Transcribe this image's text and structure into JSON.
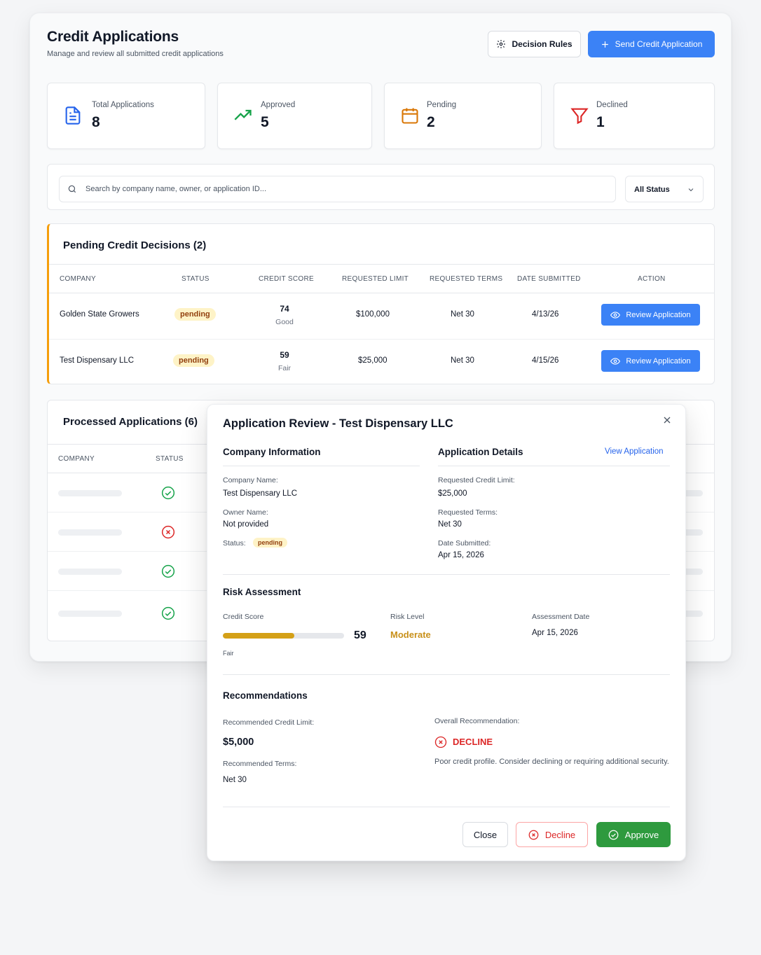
{
  "header": {
    "title": "Credit Applications",
    "subtitle": "Manage and review all submitted credit applications",
    "decision_rules_label": "Decision Rules",
    "send_label": "Send Credit Application"
  },
  "stats": [
    {
      "label": "Total Applications",
      "value": "8"
    },
    {
      "label": "Approved",
      "value": "5"
    },
    {
      "label": "Pending",
      "value": "2"
    },
    {
      "label": "Declined",
      "value": "1"
    }
  ],
  "search": {
    "placeholder": "Search by company name, owner, or application ID...",
    "status_filter": "All Status"
  },
  "pending": {
    "title": "Pending Credit Decisions (2)",
    "columns": [
      "COMPANY",
      "STATUS",
      "CREDIT SCORE",
      "REQUESTED LIMIT",
      "REQUESTED TERMS",
      "DATE SUBMITTED",
      "ACTION"
    ],
    "rows": [
      {
        "company": "Golden State Growers",
        "status": "pending",
        "score": "74",
        "score_label": "Good",
        "limit": "$100,000",
        "terms": "Net 30",
        "date": "4/13/26",
        "action": "Review Application"
      },
      {
        "company": "Test Dispensary LLC",
        "status": "pending",
        "score": "59",
        "score_label": "Fair",
        "limit": "$25,000",
        "terms": "Net 30",
        "date": "4/15/26",
        "action": "Review Application"
      }
    ]
  },
  "processed": {
    "title": "Processed Applications (6)",
    "columns": [
      "COMPANY",
      "STATUS"
    ],
    "row_statuses": [
      "approved",
      "declined",
      "approved",
      "approved"
    ]
  },
  "modal": {
    "title": "Application Review - Test Dispensary LLC",
    "company_info": {
      "title": "Company Information",
      "company_name_label": "Company Name:",
      "company_name": "Test Dispensary LLC",
      "owner_label": "Owner Name:",
      "owner": "Not provided",
      "status_label": "Status:",
      "status": "pending"
    },
    "app_details": {
      "title": "Application Details",
      "view_link": "View Application",
      "limit_label": "Requested Credit Limit:",
      "limit": "$25,000",
      "terms_label": "Requested Terms:",
      "terms": "Net 30",
      "date_label": "Date Submitted:",
      "date": "Apr 15, 2026"
    },
    "risk": {
      "title": "Risk Assessment",
      "score_label": "Credit Score",
      "score": "59",
      "score_fraction": 0.59,
      "score_desc": "Fair",
      "level_label": "Risk Level",
      "level": "Moderate",
      "date_label": "Assessment Date",
      "date": "Apr 15, 2026"
    },
    "recommendations": {
      "title": "Recommendations",
      "limit_label": "Recommended Credit Limit:",
      "limit": "$5,000",
      "terms_label": "Recommended Terms:",
      "terms": "Net 30",
      "overall_label": "Overall Recommendation:",
      "overall": "DECLINE",
      "note": "Poor credit profile. Consider declining or requiring additional security."
    },
    "buttons": {
      "close": "Close",
      "decline": "Decline",
      "approve": "Approve"
    }
  },
  "colors": {
    "primary": "#3b82f6",
    "pending_accent": "#f59e0b",
    "approve": "#2e9a3e",
    "decline": "#dc2626",
    "moderate": "#c8901a"
  }
}
